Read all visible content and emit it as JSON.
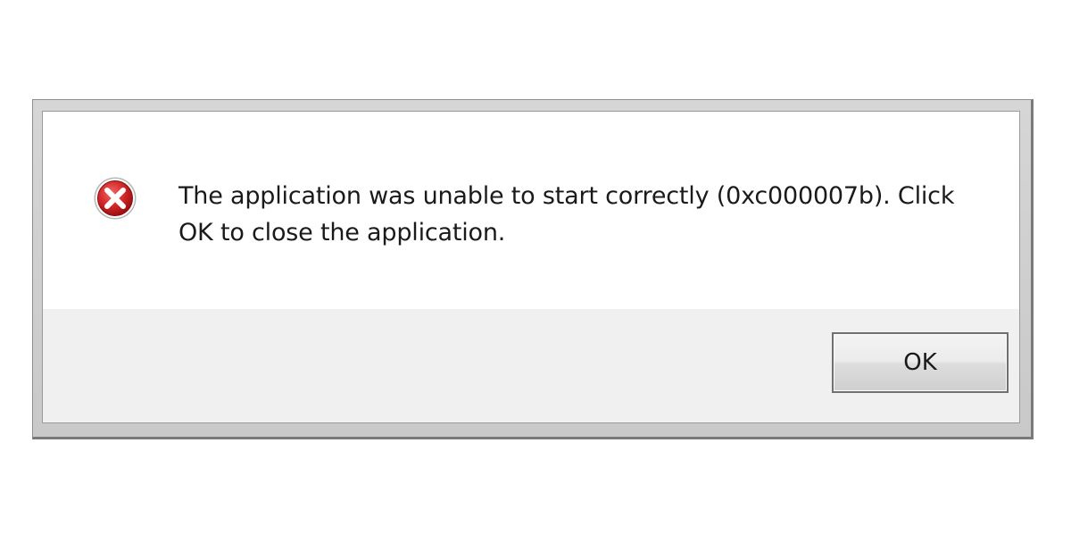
{
  "dialog": {
    "icon": "error-icon",
    "message": "The application was unable to start correctly (0xc000007b). Click OK to close the application.",
    "ok_label": "OK"
  },
  "colors": {
    "icon_red": "#c8161d",
    "button_area": "#f0f0f0",
    "message_area": "#ffffff"
  }
}
